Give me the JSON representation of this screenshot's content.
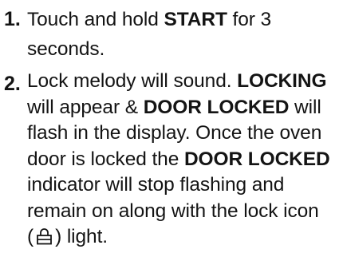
{
  "steps": [
    {
      "number": "1.",
      "t1": "Touch and hold ",
      "b1": "START",
      "t2": " for 3",
      "t3": "seconds."
    },
    {
      "number": "2.",
      "t1": "Lock melody will sound. ",
      "b1": "LOCKING",
      "t2": "will appear & ",
      "b2": "DOOR LOCKED",
      "t3": " will",
      "t4": "flash in the display. Once the oven",
      "t5": "door is locked the ",
      "b3": "DOOR LOCKED",
      "t6": "indicator will stop flashing and",
      "t7": "remain on along with the lock icon",
      "t8": "(",
      "icon": "lock-icon",
      "t9": ") light."
    }
  ]
}
